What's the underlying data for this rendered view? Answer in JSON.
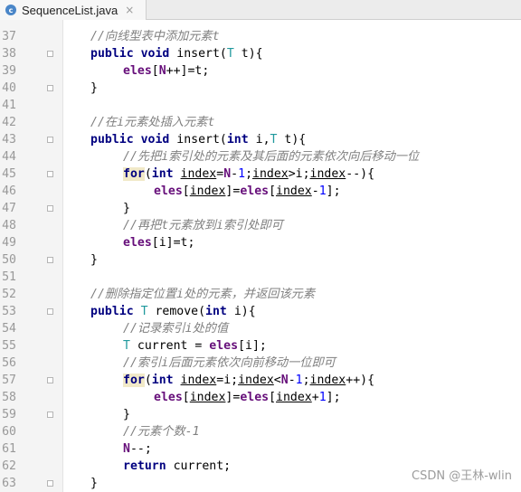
{
  "tab": {
    "icon": "c",
    "title": "SequenceList.java",
    "close": "×"
  },
  "watermark": "CSDN @王林-wlin",
  "lines": [
    {
      "n": "37",
      "seg": [
        [
          "cmt",
          "//向线型表中添加元素t"
        ]
      ]
    },
    {
      "n": "38",
      "seg": [
        [
          "kw",
          "public "
        ],
        [
          "kw",
          "void "
        ],
        [
          "pl",
          "insert("
        ],
        [
          "ty",
          "T "
        ],
        [
          "pl",
          "t){"
        ]
      ]
    },
    {
      "n": "39",
      "seg": [
        [
          "fld",
          "eles"
        ],
        [
          "pl",
          "["
        ],
        [
          "fld",
          "N"
        ],
        [
          "pl",
          "++]=t;"
        ]
      ]
    },
    {
      "n": "40",
      "seg": [
        [
          "pl",
          "}"
        ]
      ]
    },
    {
      "n": "41",
      "seg": []
    },
    {
      "n": "42",
      "seg": [
        [
          "cmt",
          "//在i元素处插入元素t"
        ]
      ]
    },
    {
      "n": "43",
      "seg": [
        [
          "kw",
          "public "
        ],
        [
          "kw",
          "void "
        ],
        [
          "pl",
          "insert("
        ],
        [
          "kw",
          "int "
        ],
        [
          "pl",
          "i,"
        ],
        [
          "ty",
          "T "
        ],
        [
          "pl",
          "t){"
        ]
      ]
    },
    {
      "n": "44",
      "seg": [
        [
          "cmt",
          "//先把i索引处的元素及其后面的元素依次向后移动一位"
        ]
      ]
    },
    {
      "n": "45",
      "seg": [
        [
          "kw hl",
          "for"
        ],
        [
          "pl",
          "("
        ],
        [
          "kw",
          "int "
        ],
        [
          "pl ul",
          "index"
        ],
        [
          "pl",
          "="
        ],
        [
          "fld",
          "N"
        ],
        [
          "pl",
          "-"
        ],
        [
          "num",
          "1"
        ],
        [
          "pl",
          ";"
        ],
        [
          "pl ul",
          "index"
        ],
        [
          "pl",
          ">i;"
        ],
        [
          "pl ul",
          "index"
        ],
        [
          "pl",
          "--){"
        ]
      ]
    },
    {
      "n": "46",
      "seg": [
        [
          "fld",
          "eles"
        ],
        [
          "pl",
          "["
        ],
        [
          "pl ul",
          "index"
        ],
        [
          "pl",
          "]="
        ],
        [
          "fld",
          "eles"
        ],
        [
          "pl",
          "["
        ],
        [
          "pl ul",
          "index"
        ],
        [
          "pl",
          "-"
        ],
        [
          "num",
          "1"
        ],
        [
          "pl",
          "];"
        ]
      ]
    },
    {
      "n": "47",
      "seg": [
        [
          "pl",
          "}"
        ]
      ]
    },
    {
      "n": "48",
      "seg": [
        [
          "cmt",
          "//再把t元素放到i索引处即可"
        ]
      ]
    },
    {
      "n": "49",
      "seg": [
        [
          "fld",
          "eles"
        ],
        [
          "pl",
          "[i]=t;"
        ]
      ]
    },
    {
      "n": "50",
      "seg": [
        [
          "pl",
          "}"
        ]
      ]
    },
    {
      "n": "51",
      "seg": []
    },
    {
      "n": "52",
      "seg": [
        [
          "cmt",
          "//删除指定位置i处的元素，并返回该元素"
        ]
      ]
    },
    {
      "n": "53",
      "seg": [
        [
          "kw",
          "public "
        ],
        [
          "ty",
          "T "
        ],
        [
          "pl",
          "remove("
        ],
        [
          "kw",
          "int "
        ],
        [
          "pl",
          "i){"
        ]
      ]
    },
    {
      "n": "54",
      "seg": [
        [
          "cmt",
          "//记录索引i处的值"
        ]
      ]
    },
    {
      "n": "55",
      "seg": [
        [
          "ty",
          "T "
        ],
        [
          "pl",
          "current = "
        ],
        [
          "fld",
          "eles"
        ],
        [
          "pl",
          "[i];"
        ]
      ]
    },
    {
      "n": "56",
      "seg": [
        [
          "cmt",
          "//索引i后面元素依次向前移动一位即可"
        ]
      ]
    },
    {
      "n": "57",
      "seg": [
        [
          "kw hl",
          "for"
        ],
        [
          "pl",
          "("
        ],
        [
          "kw",
          "int "
        ],
        [
          "pl ul",
          "index"
        ],
        [
          "pl",
          "=i;"
        ],
        [
          "pl ul",
          "index"
        ],
        [
          "pl",
          "<"
        ],
        [
          "fld",
          "N"
        ],
        [
          "pl",
          "-"
        ],
        [
          "num",
          "1"
        ],
        [
          "pl",
          ";"
        ],
        [
          "pl ul",
          "index"
        ],
        [
          "pl",
          "++){"
        ]
      ]
    },
    {
      "n": "58",
      "seg": [
        [
          "fld",
          "eles"
        ],
        [
          "pl",
          "["
        ],
        [
          "pl ul",
          "index"
        ],
        [
          "pl",
          "]="
        ],
        [
          "fld",
          "eles"
        ],
        [
          "pl",
          "["
        ],
        [
          "pl ul",
          "index"
        ],
        [
          "pl",
          "+"
        ],
        [
          "num",
          "1"
        ],
        [
          "pl",
          "];"
        ]
      ]
    },
    {
      "n": "59",
      "seg": [
        [
          "pl",
          "}"
        ]
      ]
    },
    {
      "n": "60",
      "seg": [
        [
          "cmt",
          "//元素个数-1"
        ]
      ]
    },
    {
      "n": "61",
      "seg": [
        [
          "fld",
          "N"
        ],
        [
          "pl",
          "--;"
        ]
      ]
    },
    {
      "n": "62",
      "seg": [
        [
          "kw",
          "return "
        ],
        [
          "pl",
          "current;"
        ]
      ]
    },
    {
      "n": "63",
      "seg": [
        [
          "pl",
          "}"
        ]
      ]
    }
  ]
}
